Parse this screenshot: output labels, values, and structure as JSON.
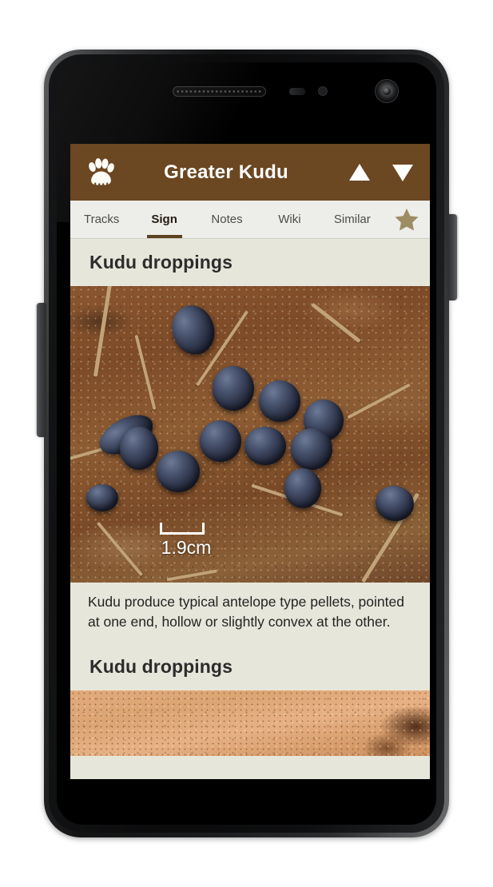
{
  "app": {
    "title": "Greater Kudu",
    "paw_icon": "paw-print-icon",
    "prev_icon": "triangle-up-icon",
    "next_icon": "triangle-down-icon",
    "header_color": "#6b4722",
    "tabbar_color": "#ededea",
    "content_color": "#e7e6da",
    "star_color": "#9e8c63",
    "active_tab_underline_color": "#5b431f"
  },
  "tabs": [
    {
      "label": "Tracks",
      "active": false
    },
    {
      "label": "Sign",
      "active": true
    },
    {
      "label": "Notes",
      "active": false
    },
    {
      "label": "Wiki",
      "active": false
    },
    {
      "label": "Similar",
      "active": false
    }
  ],
  "favorite": {
    "icon": "star-icon",
    "filled": true
  },
  "sections": [
    {
      "heading": "Kudu droppings",
      "image": {
        "name": "kudu-droppings-photo",
        "scale_label": "1.9cm",
        "description": "Cluster of dark blue-black antelope pellets on reddish-brown soil with twigs and debris"
      },
      "body": "Kudu produce typical antelope type pellets, pointed at one end, hollow or slightly convex at the other."
    },
    {
      "heading": "Kudu droppings",
      "image": {
        "name": "kudu-droppings-photo-2",
        "description": "Light sandy orange soil with a dark brown dung patch at the right edge"
      }
    }
  ]
}
